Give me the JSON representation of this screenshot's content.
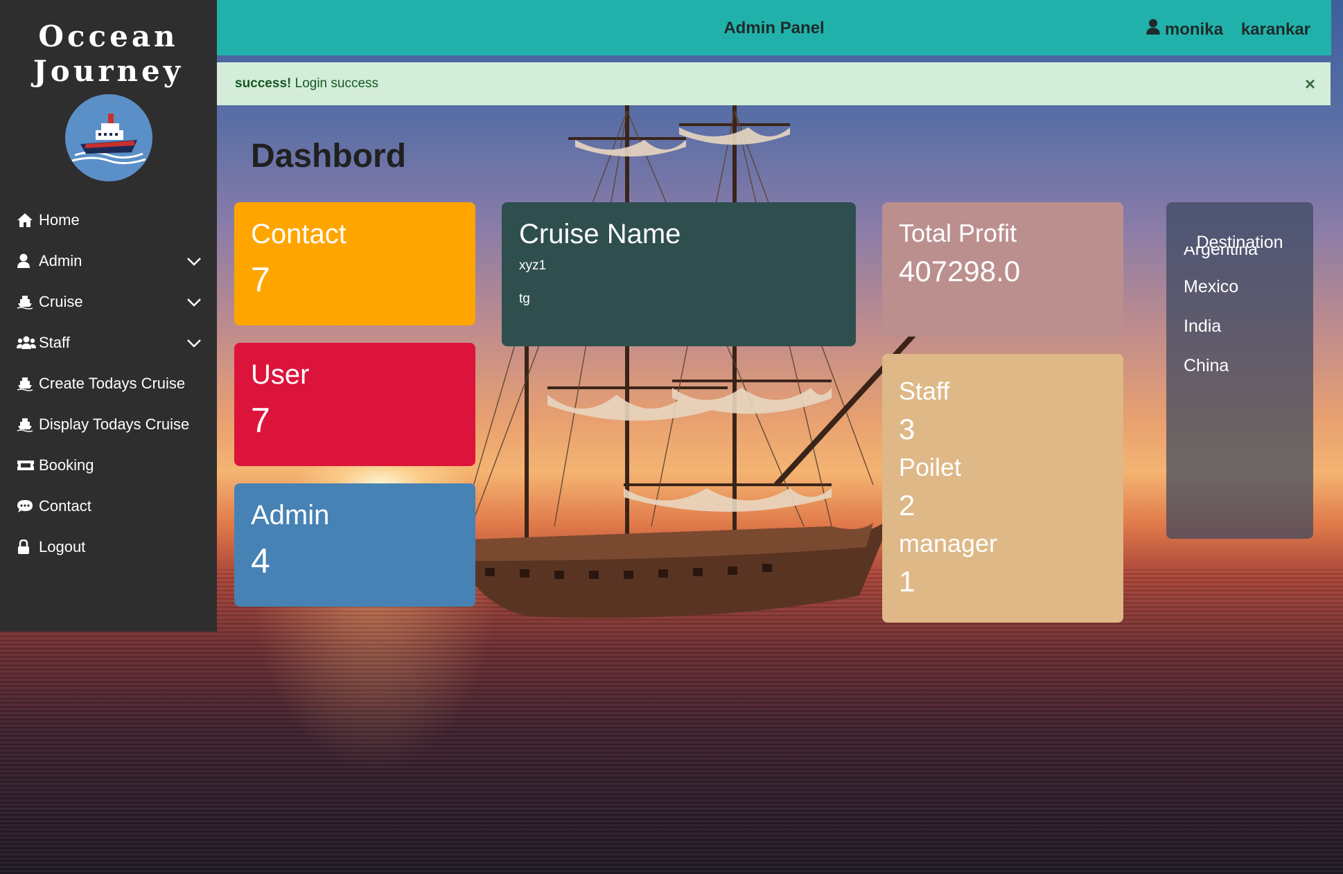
{
  "brand": {
    "line1": "Occean",
    "line2": "Journey"
  },
  "sidebar": {
    "items": [
      {
        "label": "Home",
        "icon": "home-icon",
        "dropdown": false
      },
      {
        "label": "Admin",
        "icon": "user-icon",
        "dropdown": true
      },
      {
        "label": "Cruise",
        "icon": "ship-icon",
        "dropdown": true
      },
      {
        "label": "Staff",
        "icon": "users-icon",
        "dropdown": true
      },
      {
        "label": "Create Todays Cruise",
        "icon": "ship-icon",
        "dropdown": false
      },
      {
        "label": "Display Todays Cruise",
        "icon": "ship-icon",
        "dropdown": false
      },
      {
        "label": "Booking",
        "icon": "ticket-icon",
        "dropdown": false
      },
      {
        "label": "Contact",
        "icon": "chat-icon",
        "dropdown": false
      },
      {
        "label": "Logout",
        "icon": "lock-icon",
        "dropdown": false
      }
    ]
  },
  "topbar": {
    "title": "Admin Panel",
    "user_first": "monika",
    "user_last": "karankar",
    "color": "#20b2aa"
  },
  "alert": {
    "strong": "success!",
    "message": "Login success",
    "close": "×"
  },
  "page": {
    "title": "Dashbord"
  },
  "cards": {
    "contact": {
      "label": "Contact",
      "value": "7",
      "color": "#ffa500"
    },
    "user": {
      "label": "User",
      "value": "7",
      "color": "#dc143c"
    },
    "admin": {
      "label": "Admin",
      "value": "4",
      "color": "#4682b4"
    },
    "cruise": {
      "label": "Cruise Name",
      "items": [
        "xyz1",
        "tg"
      ],
      "color": "#2f4f4f"
    },
    "profit": {
      "label": "Total Profit",
      "value": "407298.0",
      "color": "#bc8f8f"
    },
    "staff": {
      "color": "#deb887",
      "rows": [
        {
          "label": "Staff",
          "value": "3"
        },
        {
          "label": "Poilet",
          "value": "2"
        },
        {
          "label": "manager",
          "value": "1"
        }
      ]
    },
    "destination": {
      "label": "Destination",
      "items": [
        "Argentina",
        "Mexico",
        "India",
        "China"
      ]
    }
  }
}
